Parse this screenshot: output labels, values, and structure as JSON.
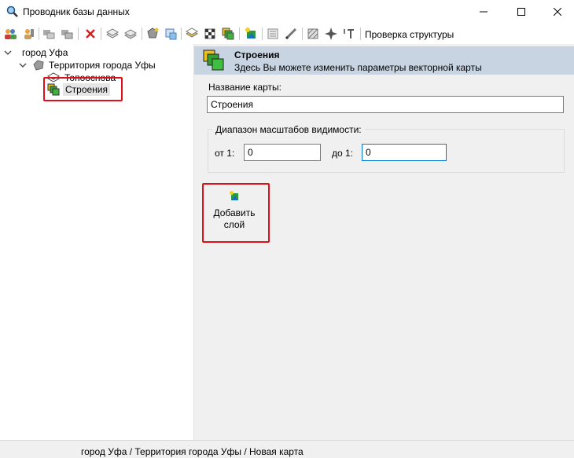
{
  "window": {
    "title": "Проводник базы данных",
    "minimize": "—",
    "maximize": "☐",
    "close": "✕"
  },
  "toolbar": {
    "check_structure": "Проверка структуры",
    "icons": [
      "users-icon",
      "user-key-icon",
      "cut-icon",
      "paste-icon",
      "delete-icon",
      "layer-add-icon",
      "layers-icon",
      "map-settings-icon",
      "import-icon",
      "style-icon",
      "checker-icon",
      "map-layers-icon",
      "add-layer-icon",
      "list-icon",
      "pencil-icon",
      "hatch-icon",
      "move-icon",
      "text-tool-icon"
    ]
  },
  "tree": {
    "root": "город Уфа",
    "territory": "Территория города Уфы",
    "topo": "Топооснова",
    "buildings": "Строения"
  },
  "panel": {
    "header_title": "Строения",
    "header_subtitle": "Здесь Вы можете изменить параметры векторной карты",
    "map_name_label": "Название карты:",
    "map_name_value": "Строения",
    "scale_group_label": "Диапазон масштабов видимости:",
    "from_label": "от 1:",
    "from_value": "0",
    "to_label": "до 1:",
    "to_value": "0",
    "add_layer_label": "Добавить слой"
  },
  "status": {
    "path": "город Уфа / Территория города Уфы / Новая карта"
  },
  "colors": {
    "highlight": "#e0101b",
    "header_bg": "#c8d4e2",
    "focus_border": "#0078d7"
  }
}
